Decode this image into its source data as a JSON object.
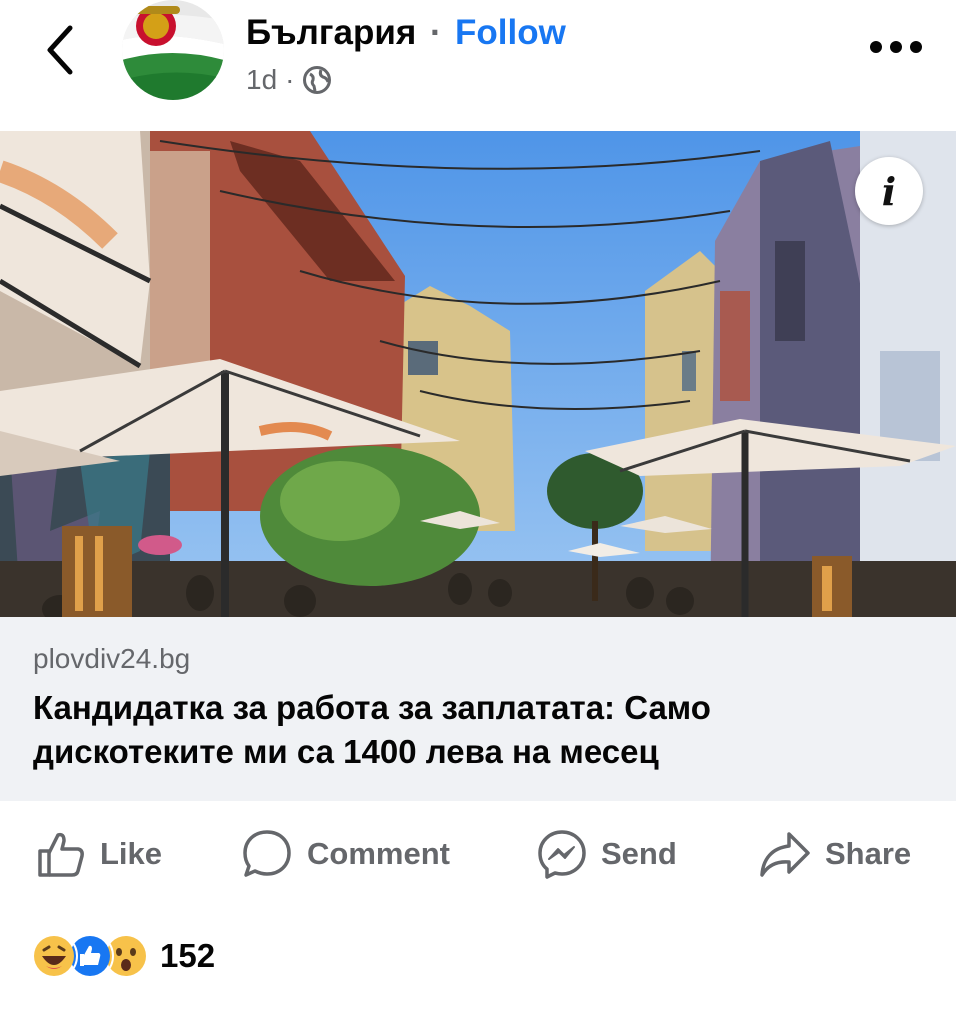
{
  "header": {
    "page_name": "България",
    "separator": "·",
    "follow_label": "Follow",
    "time": "1d",
    "dot": "·",
    "privacy_icon": "globe-icon"
  },
  "post": {
    "image_alt": "Street with cafe umbrellas and hanging lights in Plovdiv",
    "link": {
      "domain": "plovdiv24.bg",
      "headline": "Кандидатка за работа за заплатата: Само дискотеките ми са 1400 лева на месец"
    }
  },
  "actions": {
    "like": "Like",
    "comment": "Comment",
    "send": "Send",
    "share": "Share"
  },
  "reactions": {
    "icons": [
      "haha-emoji",
      "like-emoji",
      "wow-emoji"
    ],
    "count": "152"
  },
  "colors": {
    "brand": "#1877f2",
    "secondary_text": "#65676b",
    "card_bg": "#f0f2f5"
  }
}
